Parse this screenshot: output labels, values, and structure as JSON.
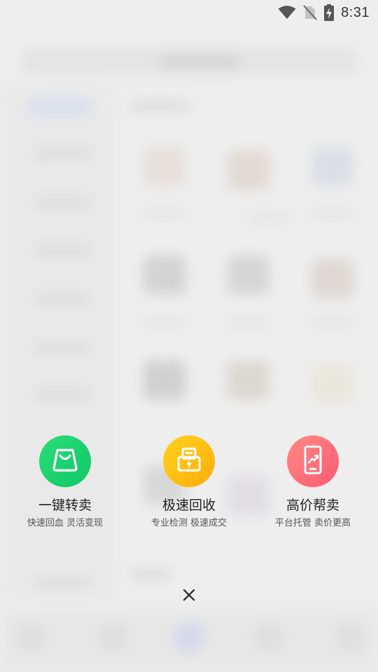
{
  "status_bar": {
    "time": "8:31",
    "icons": [
      "wifi-icon",
      "no-sim-icon",
      "battery-charging-icon"
    ]
  },
  "actions": [
    {
      "title": "一键转卖",
      "subtitle": "快速回血 灵活变现",
      "icon": "shopping-bag-icon",
      "color_from": "#2bdd7a",
      "color_to": "#0fc865"
    },
    {
      "title": "极速回收",
      "subtitle": "专业检测 极速成交",
      "icon": "lightning-box-icon",
      "color_from": "#ffd21e",
      "color_to": "#ffad0a"
    },
    {
      "title": "高价帮卖",
      "subtitle": "平台托管 卖价更高",
      "icon": "phone-trend-icon",
      "color_from": "#ff8a82",
      "color_to": "#ff5a74"
    }
  ],
  "close": {
    "icon": "close-icon"
  }
}
